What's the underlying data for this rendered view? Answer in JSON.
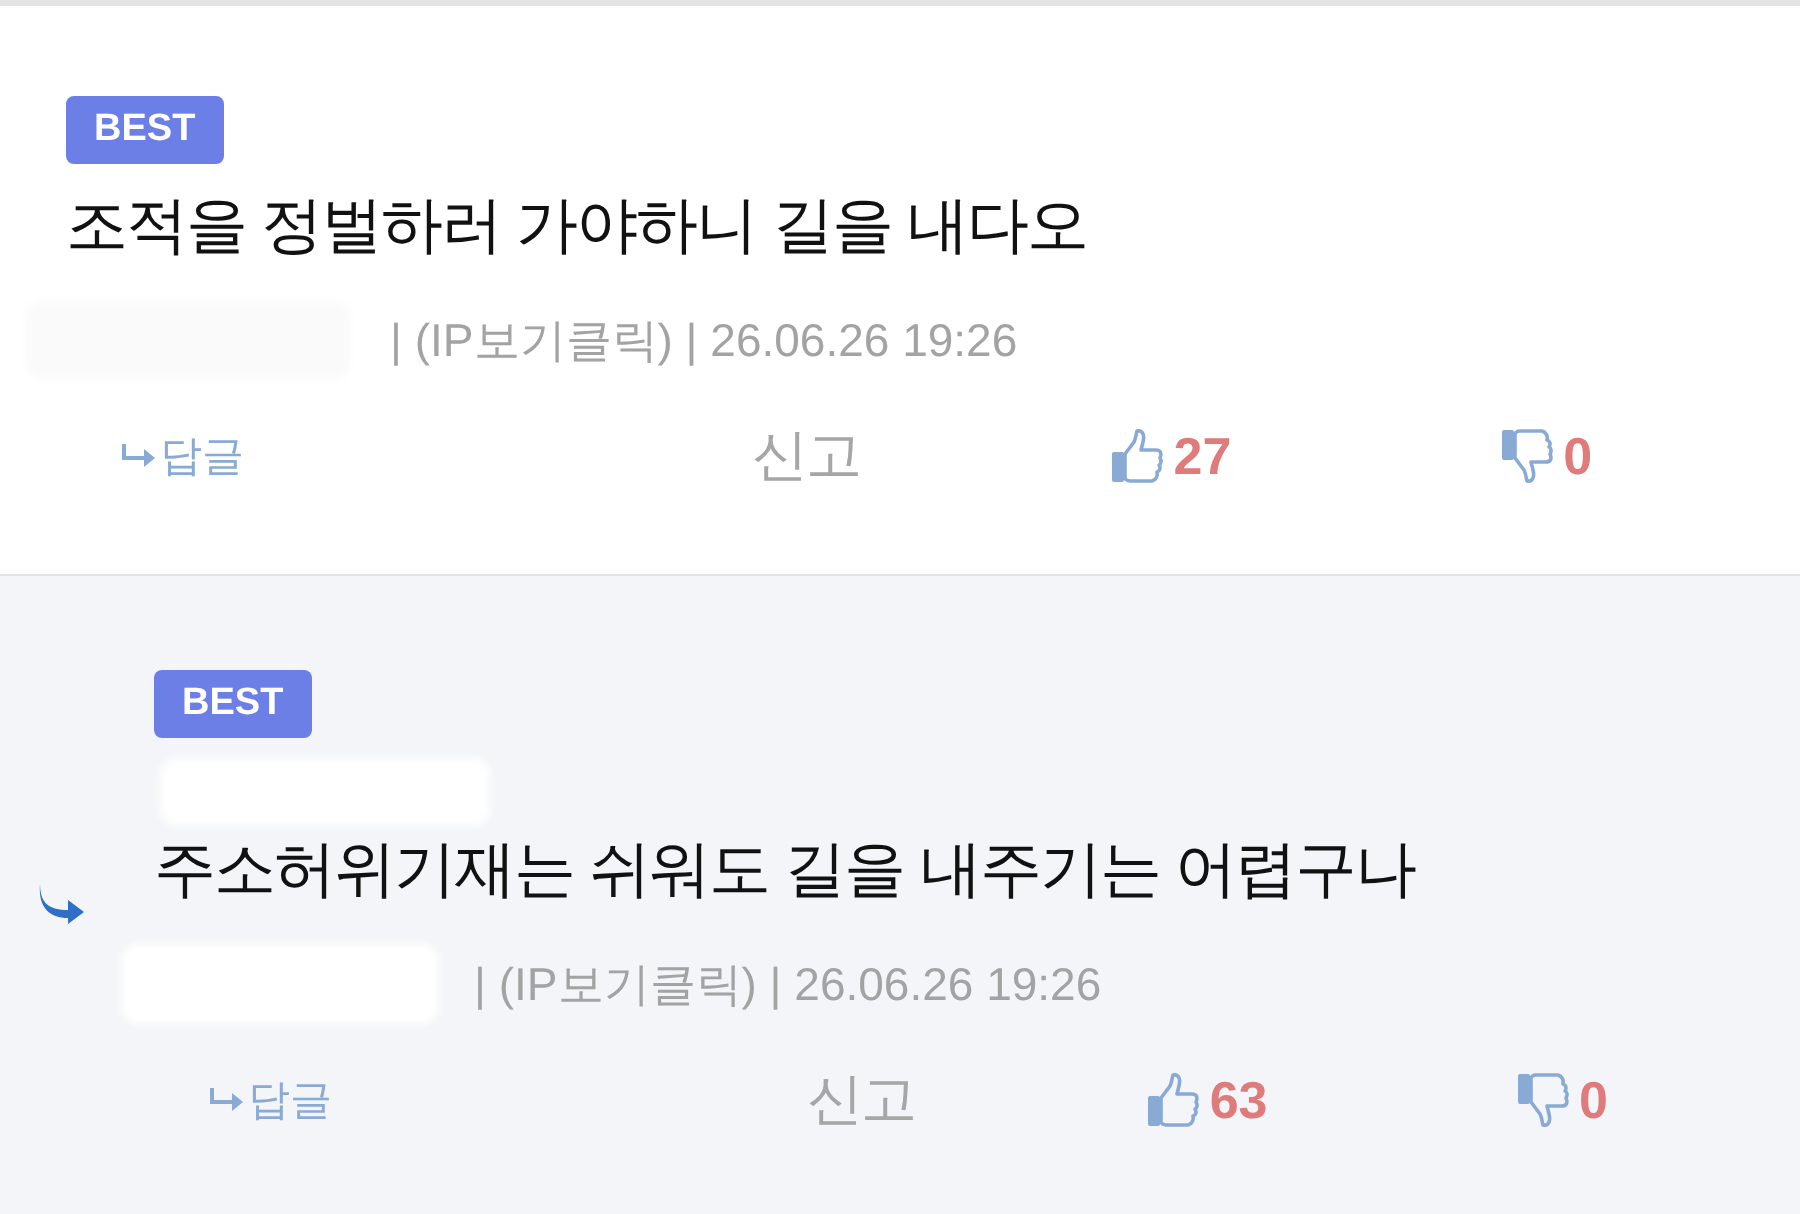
{
  "comments": [
    {
      "kind": "comment",
      "badge": "BEST",
      "text": "조적을 정벌하러 가야하니 길을 내다오",
      "meta": "| (IP보기클릭) | 26.06.26 19:26",
      "reply": "답글",
      "report": "신고",
      "likes": "27",
      "dislikes": "0"
    },
    {
      "kind": "reply",
      "badge": "BEST",
      "text": "주소허위기재는 쉬워도 길을 내주기는 어렵구나",
      "meta": "| (IP보기클릭) | 26.06.26 19:26",
      "reply": "답글",
      "report": "신고",
      "likes": "63",
      "dislikes": "0"
    }
  ]
}
